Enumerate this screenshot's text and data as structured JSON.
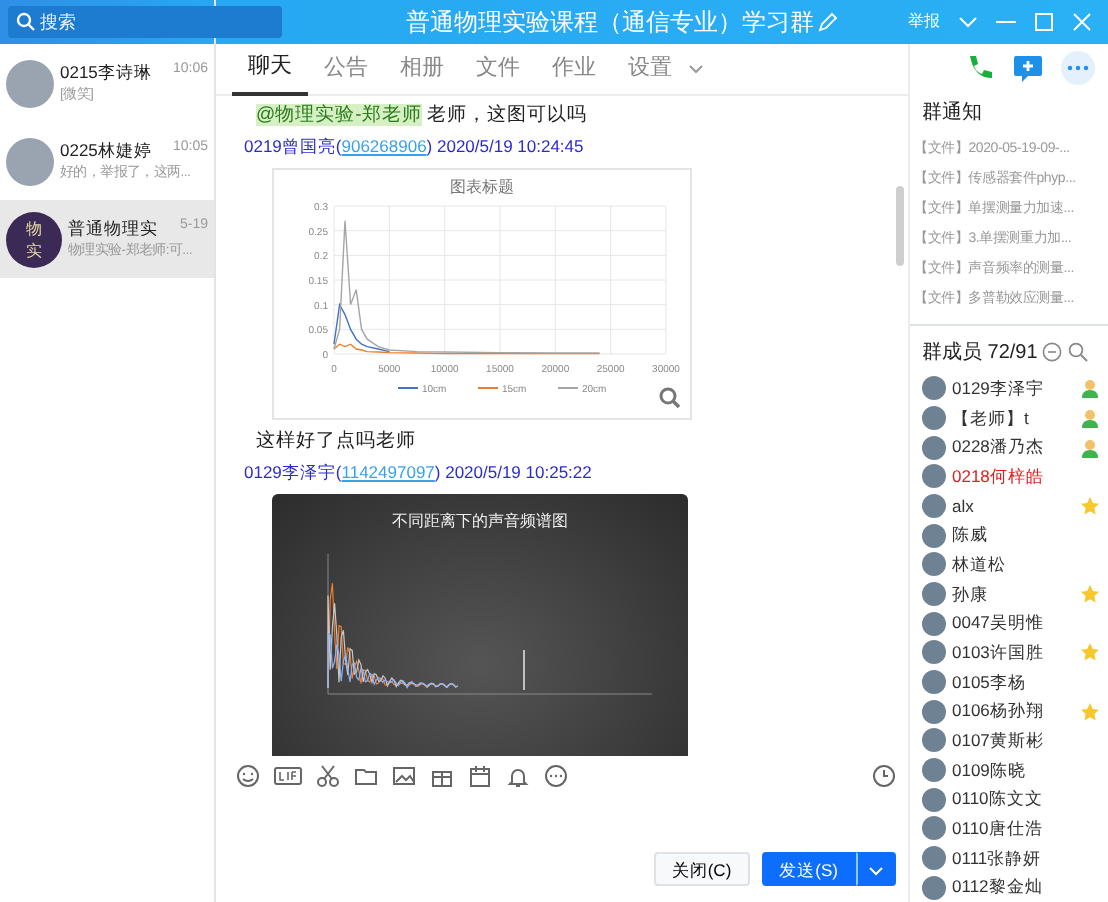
{
  "window": {
    "search_placeholder": "搜索",
    "title": "普通物理实验课程（通信专业）学习群",
    "report": "举报"
  },
  "conversations": [
    {
      "name": "0215李诗琳",
      "time": "10:06",
      "preview": "[微笑]",
      "selected": false
    },
    {
      "name": "0225林婕婷",
      "time": "10:05",
      "preview": "好的，举报了，这两...",
      "selected": false
    },
    {
      "name": "普通物理实",
      "time": "5-19",
      "preview": "物理实验-郑老师:可...",
      "selected": true,
      "avatar_text": "物实"
    }
  ],
  "tabs": [
    {
      "label": "聊天",
      "selected": true
    },
    {
      "label": "公告",
      "selected": false
    },
    {
      "label": "相册",
      "selected": false
    },
    {
      "label": "文件",
      "selected": false
    },
    {
      "label": "作业",
      "selected": false
    },
    {
      "label": "设置",
      "selected": false
    }
  ],
  "messages": [
    {
      "kind": "text",
      "mention": "@物理实验-郑老师",
      "text": "老师，这图可以吗"
    },
    {
      "kind": "header",
      "sender": "0219曾国亮(",
      "qq": "906268906",
      "time": ") 2020/5/19 10:24:45"
    },
    {
      "kind": "light_chart",
      "chart_data": {
        "type": "line",
        "title": "图表标题",
        "x": [
          0,
          500,
          1000,
          1500,
          2000,
          2500,
          3000,
          4000,
          5000,
          7500,
          10000,
          15000,
          20000,
          24000
        ],
        "series": [
          {
            "name": "10cm",
            "color": "#4472c4",
            "values": [
              0.02,
              0.1,
              0.08,
              0.05,
              0.03,
              0.02,
              0.015,
              0.01,
              0.005,
              null,
              null,
              null,
              null,
              null
            ]
          },
          {
            "name": "15cm",
            "color": "#ed7d31",
            "values": [
              0.01,
              0.02,
              0.015,
              0.02,
              0.01,
              0.008,
              0.005,
              0.004,
              0.003,
              0.002,
              0.001,
              0.001,
              0.001,
              0.001
            ]
          },
          {
            "name": "20cm",
            "color": "#a5a5a5",
            "values": [
              0.01,
              0.05,
              0.27,
              0.1,
              0.13,
              0.05,
              0.03,
              0.015,
              0.008,
              0.005,
              0.004,
              0.003,
              0.002,
              0.002
            ]
          }
        ],
        "grid": true,
        "legend": "bottom",
        "xlim": [
          0,
          30000
        ],
        "ylim": [
          0,
          0.3
        ],
        "xticks": [
          0,
          5000,
          10000,
          15000,
          20000,
          25000,
          30000
        ],
        "yticks": [
          0,
          0.05,
          0.1,
          0.15,
          0.2,
          0.25,
          0.3
        ]
      }
    },
    {
      "kind": "text",
      "text": "这样好了点吗老师"
    },
    {
      "kind": "header",
      "sender": "0129李泽宇(",
      "qq": "1142497097",
      "time": ") 2020/5/19 10:25:22"
    },
    {
      "kind": "dark_chart",
      "title": "不同距离下的声音频谱图"
    }
  ],
  "buttons": {
    "close": "关闭(C)",
    "send": "发送(S)"
  },
  "notices": {
    "title": "群通知",
    "items": [
      "【文件】2020-05-19-09-...",
      "【文件】传感器套件phyp...",
      "【文件】单摆测量力加速...",
      "【文件】3.单摆测重力加...",
      "【文件】声音频率的测量...",
      "【文件】多普勒效应测量..."
    ]
  },
  "members": {
    "title": "群成员 72/91",
    "items": [
      {
        "name": "0129李泽宇",
        "kind": "owner",
        "color": "#333333"
      },
      {
        "name": "【老师】t",
        "kind": "owner",
        "color": "#333333"
      },
      {
        "name": "0228潘乃杰",
        "kind": "owner",
        "color": "#333333"
      },
      {
        "name": "0218何梓皓",
        "kind": "member",
        "color": "#e02020"
      },
      {
        "name": "alx",
        "kind": "starred",
        "color": "#333333"
      },
      {
        "name": "陈威",
        "kind": "member",
        "color": "#333333"
      },
      {
        "name": "林道松",
        "kind": "member",
        "color": "#333333"
      },
      {
        "name": "孙康",
        "kind": "starred",
        "color": "#333333"
      },
      {
        "name": "0047吴明惟",
        "kind": "member",
        "color": "#333333"
      },
      {
        "name": "0103许国胜",
        "kind": "starred",
        "color": "#333333"
      },
      {
        "name": "0105李杨",
        "kind": "member",
        "color": "#333333"
      },
      {
        "name": "0106杨孙翔",
        "kind": "starred",
        "color": "#333333"
      },
      {
        "name": "0107黄斯彬",
        "kind": "member",
        "color": "#333333"
      },
      {
        "name": "0109陈晓",
        "kind": "member",
        "color": "#333333"
      },
      {
        "name": "0110陈文文",
        "kind": "member",
        "color": "#333333"
      },
      {
        "name": "0110唐仕浩",
        "kind": "member",
        "color": "#333333"
      },
      {
        "name": "0111张静妍",
        "kind": "member",
        "color": "#333333"
      },
      {
        "name": "0112黎金灿",
        "kind": "member",
        "color": "#333333"
      }
    ]
  }
}
